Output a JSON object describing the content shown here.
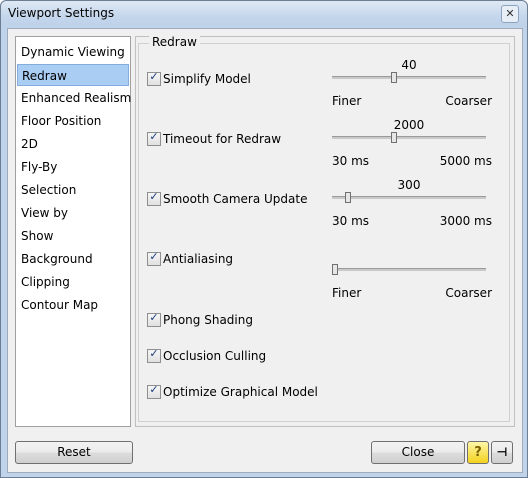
{
  "window": {
    "title": "Viewport Settings",
    "close_glyph": "✕"
  },
  "nav": {
    "items": [
      {
        "label": "Dynamic Viewing"
      },
      {
        "label": "Redraw"
      },
      {
        "label": "Enhanced Realism"
      },
      {
        "label": "Floor Position"
      },
      {
        "label": "2D"
      },
      {
        "label": "Fly-By"
      },
      {
        "label": "Selection"
      },
      {
        "label": "View by"
      },
      {
        "label": "Show"
      },
      {
        "label": "Background"
      },
      {
        "label": "Clipping"
      },
      {
        "label": "Contour Map"
      }
    ],
    "selected": "Redraw"
  },
  "redraw": {
    "group_label": "Redraw",
    "simplify_model": {
      "label": "Simplify Model",
      "checked": true,
      "value": "40",
      "min_label": "Finer",
      "max_label": "Coarser",
      "level": 0.4
    },
    "timeout_for_redraw": {
      "label": "Timeout for Redraw",
      "checked": true,
      "value": "2000",
      "min_label": "30 ms",
      "max_label": "5000 ms",
      "level": 0.4
    },
    "smooth_camera_update": {
      "label": "Smooth Camera Update",
      "checked": true,
      "value": "300",
      "min_label": "30 ms",
      "max_label": "3000 ms",
      "level": 0.09
    },
    "antialiasing": {
      "label": "Antialiasing",
      "checked": true,
      "min_label": "Finer",
      "max_label": "Coarser",
      "level": 0.0
    },
    "phong_shading": {
      "label": "Phong Shading",
      "checked": true
    },
    "occlusion_culling": {
      "label": "Occlusion Culling",
      "checked": true
    },
    "optimize_graphical_model": {
      "label": "Optimize Graphical Model",
      "checked": true
    }
  },
  "footer": {
    "reset_label": "Reset",
    "close_label": "Close",
    "help_glyph": "?",
    "pin_glyph": "⊣"
  },
  "colors": {
    "selection": "#aacdf4",
    "help_icon": "#f2d21c"
  }
}
